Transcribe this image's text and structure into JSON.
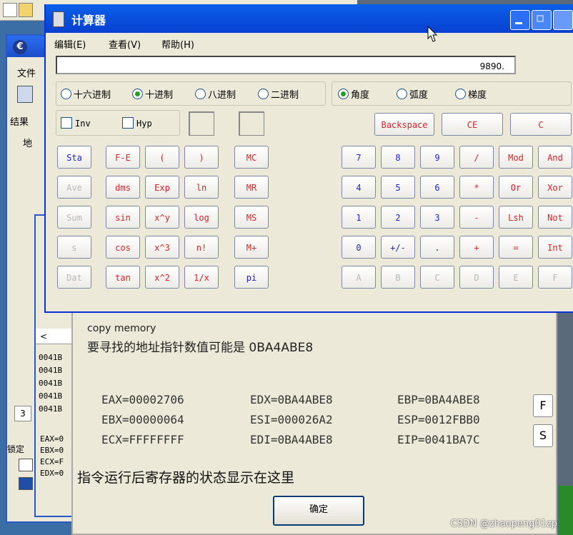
{
  "background": {
    "menu_file": "文件",
    "results_label": "结果",
    "address_label": "地",
    "scroll_left": "<",
    "addresses": [
      "0041B",
      "0041B",
      "0041B",
      "0041B",
      "0041B"
    ],
    "regs_short": [
      "EAX=0",
      "EBX=0",
      "ECX=F",
      "EDX=0"
    ],
    "locked_label": "锁定",
    "small_btn": "3"
  },
  "calculator": {
    "title": "计算器",
    "menu": [
      "编辑(E)",
      "查看(V)",
      "帮助(H)"
    ],
    "display": "9890.",
    "bases": [
      {
        "label": "十六进制",
        "on": false
      },
      {
        "label": "十进制",
        "on": true
      },
      {
        "label": "八进制",
        "on": false
      },
      {
        "label": "二进制",
        "on": false
      }
    ],
    "angles": [
      {
        "label": "角度",
        "on": true
      },
      {
        "label": "弧度",
        "on": false
      },
      {
        "label": "梯度",
        "on": false
      }
    ],
    "inv": "Inv",
    "hyp": "Hyp",
    "edit_keys": [
      "Backspace",
      "CE",
      "C"
    ],
    "stat_keys": [
      "Sta",
      "Ave",
      "Sum",
      "s",
      "Dat"
    ],
    "sci_keys": [
      [
        "F-E",
        "(",
        ")"
      ],
      [
        "dms",
        "Exp",
        "ln"
      ],
      [
        "sin",
        "x^y",
        "log"
      ],
      [
        "cos",
        "x^3",
        "n!"
      ],
      [
        "tan",
        "x^2",
        "1/x"
      ]
    ],
    "mem_keys": [
      "MC",
      "MR",
      "MS",
      "M+",
      "pi"
    ],
    "num_keys": [
      [
        "7",
        "8",
        "9",
        "/",
        "Mod",
        "And"
      ],
      [
        "4",
        "5",
        "6",
        "*",
        "Or",
        "Xor"
      ],
      [
        "1",
        "2",
        "3",
        "-",
        "Lsh",
        "Not"
      ],
      [
        "0",
        "+/-",
        ".",
        "+",
        "=",
        "Int"
      ],
      [
        "A",
        "B",
        "C",
        "D",
        "E",
        "F"
      ]
    ]
  },
  "dialog": {
    "caption": "copy memory",
    "message": "要寻找的地址指针数值可能是 0BA4ABE8",
    "registers": [
      [
        "EAX=00002706",
        "EDX=0BA4ABE8",
        "EBP=0BA4ABE8"
      ],
      [
        "EBX=00000064",
        "ESI=000026A2",
        "ESP=0012FBB0"
      ],
      [
        "ECX=FFFFFFFF",
        "EDI=0BA4ABE8",
        "EIP=0041BA7C"
      ]
    ],
    "f_button": "F",
    "s_button": "S",
    "note": "指令运行后寄存器的状态显示在这里",
    "ok": "确定"
  },
  "watermark": "CSDN @zhaopeng01zp"
}
